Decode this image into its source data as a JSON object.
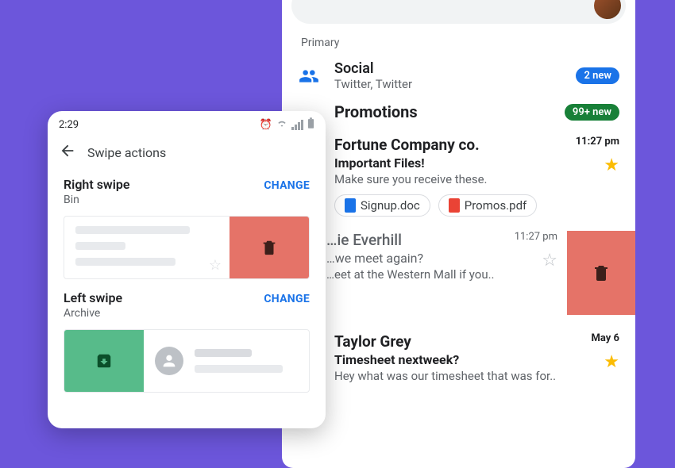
{
  "settings": {
    "clock": "2:29",
    "title": "Swipe actions",
    "right": {
      "title": "Right swipe",
      "sub": "Bin",
      "change": "CHANGE"
    },
    "left": {
      "title": "Left swipe",
      "sub": "Archive",
      "change": "CHANGE"
    }
  },
  "inbox": {
    "primary_label": "Primary",
    "social": {
      "title": "Social",
      "sub": "Twitter, Twitter",
      "badge": "2 new"
    },
    "promotions": {
      "title": "Promotions",
      "badge": "99+ new"
    },
    "emails": [
      {
        "sender": "Fortune Company co.",
        "subject": "Important Files!",
        "preview": "Make sure you receive these.",
        "time": "11:27 pm",
        "starred": true,
        "attachments": [
          "Signup.doc",
          "Promos.pdf"
        ]
      },
      {
        "sender": "…ie Everhill",
        "subject": "…we meet again?",
        "preview": "…eet at the Western Mall if you..",
        "time": "11:27 pm",
        "starred": false
      },
      {
        "sender": "Taylor Grey",
        "subject": "Timesheet nextweek?",
        "preview": "Hey what was our timesheet that was for..",
        "time": "May 6",
        "starred": true
      }
    ]
  }
}
